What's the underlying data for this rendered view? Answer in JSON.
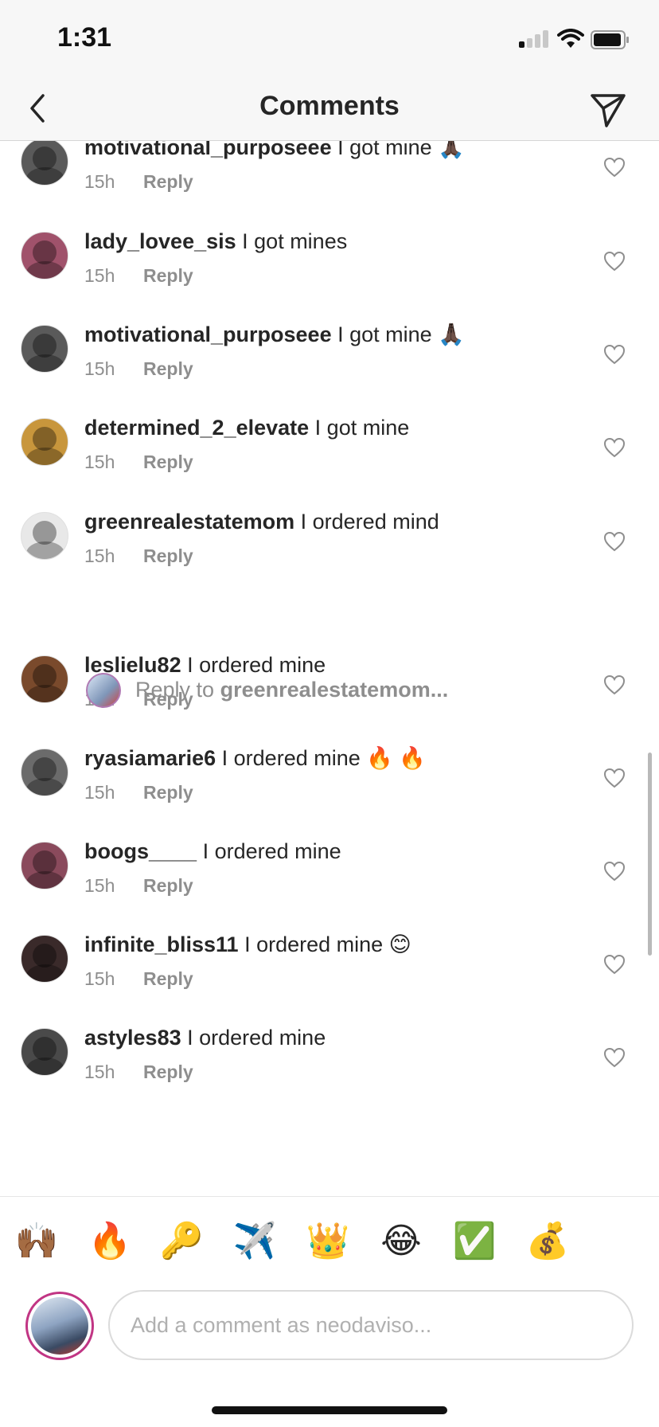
{
  "status_bar": {
    "time": "1:31"
  },
  "nav": {
    "title": "Comments"
  },
  "comments": [
    {
      "username": "motivational_purposeee",
      "text": "I got mine 🙏🏿",
      "time": "15h",
      "reply_label": "Reply",
      "avatar_color": "#5a5a5a"
    },
    {
      "username": "lady_lovee_sis",
      "text": "I got mines",
      "time": "15h",
      "reply_label": "Reply",
      "avatar_color": "#a0526b"
    },
    {
      "username": "motivational_purposeee",
      "text": "I got mine 🙏🏿",
      "time": "15h",
      "reply_label": "Reply",
      "avatar_color": "#5a5a5a"
    },
    {
      "username": "determined_2_elevate",
      "text": "I got mine",
      "time": "15h",
      "reply_label": "Reply",
      "avatar_color": "#c8963c"
    },
    {
      "username": "greenrealestatemom",
      "text": "I ordered mind",
      "time": "15h",
      "reply_label": "Reply",
      "avatar_color": "#e8e8e8"
    },
    {
      "username": "leslielu82",
      "text": "I ordered mine",
      "time": "15h",
      "reply_label": "Reply",
      "avatar_color": "#7a4a2c"
    },
    {
      "username": "ryasiamarie6",
      "text": "I ordered mine 🔥 🔥",
      "time": "15h",
      "reply_label": "Reply",
      "avatar_color": "#6b6b6b"
    },
    {
      "username": "boogs____",
      "text": "I ordered mine",
      "time": "15h",
      "reply_label": "Reply",
      "avatar_color": "#8a4a5c"
    },
    {
      "username": "infinite_bliss11",
      "text": "I ordered mine 😊",
      "time": "15h",
      "reply_label": "Reply",
      "avatar_color": "#3a2a2a"
    },
    {
      "username": "astyles83",
      "text": "I ordered mine",
      "time": "15h",
      "reply_label": "Reply",
      "avatar_color": "#4a4a4a"
    }
  ],
  "reply_prompt": {
    "prefix": "Reply to",
    "username": "greenrealestatemom..."
  },
  "emoji_bar": [
    "🙌🏾",
    "🔥",
    "🔑",
    "✈️",
    "👑",
    "😂",
    "✅",
    "💰"
  ],
  "comment_input": {
    "placeholder": "Add a comment as neodaviso..."
  },
  "colors": {
    "accent": "#262626",
    "muted": "#8e8e8e",
    "story_ring": "#c13584"
  }
}
